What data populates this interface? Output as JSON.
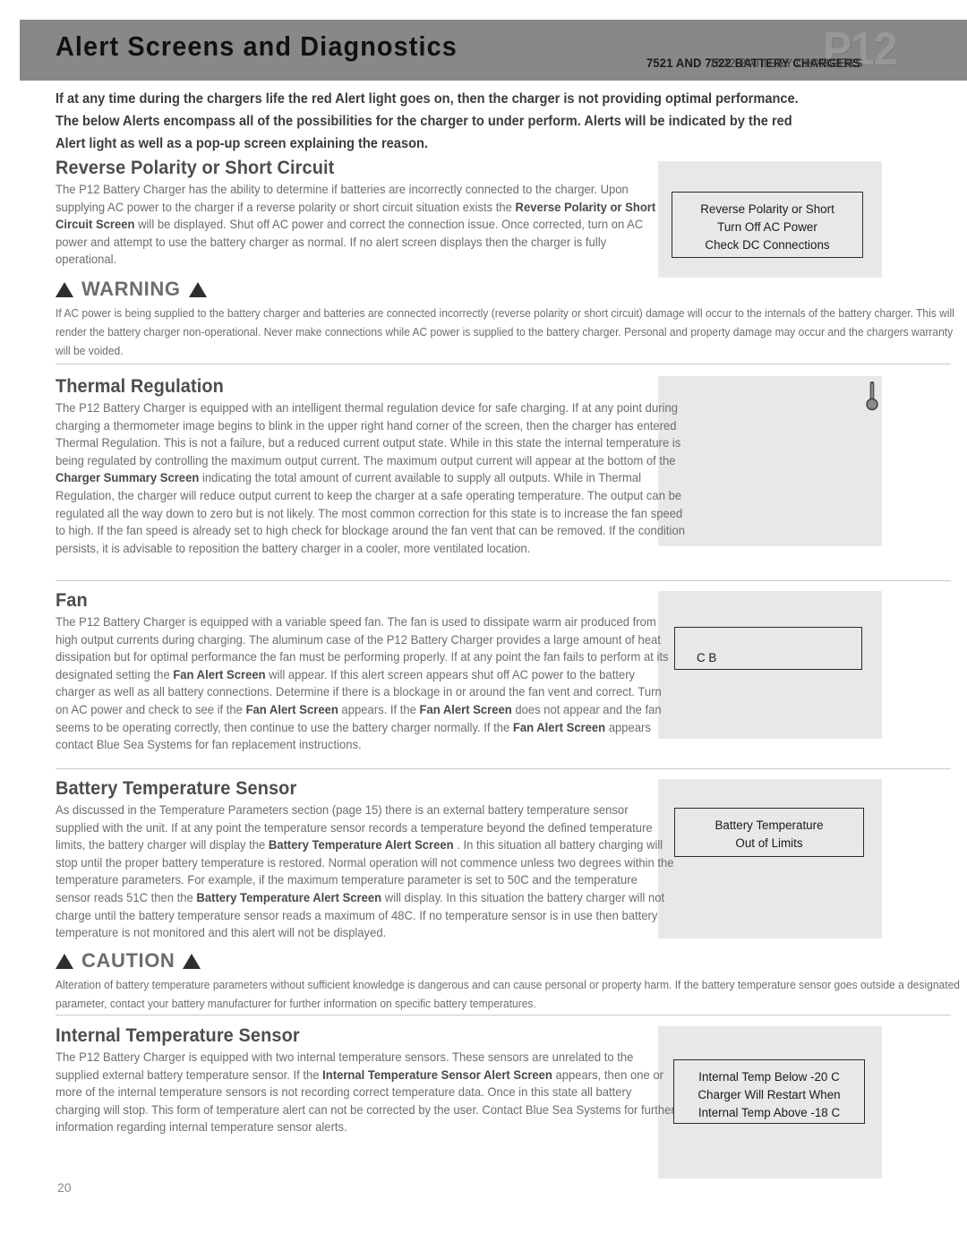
{
  "header": {
    "title": "Alert Screens and Diagnostics",
    "watermark": "P12",
    "subtitle": "7521 AND 7522 BATTERY CHARGERS",
    "subtitle_overlay": "7522 BATTERY CHARGERS"
  },
  "lead": "If at any time during the chargers life the red Alert light goes on, then the charger is not providing optimal performance. The below Alerts encompass all of the possibilities for the charger to under perform.  Alerts will be indicated by the red Alert light as well as a pop-up screen explaining the reason.",
  "sections": {
    "reverse_polarity": {
      "title": "Reverse Polarity or Short Circuit",
      "p1a": "The P12 Battery Charger has the ability to determine if batteries are incorrectly connected to the charger. Upon supplying ",
      "p1b": "AC",
      "p1c": " power to the charger if a reverse polarity or short circuit situation exists the ",
      "emph1": "Reverse Polarity or Short Circuit Screen",
      "p1d": " will be displayed. Shut off ",
      "p1e": "AC",
      "p1f": " power and correct the connection issue. ",
      "p1g": "On",
      "p1h": "ce corrected, turn on ",
      "p1i": "AC",
      "p1j": " power and attempt to use the battery charger as normal. If no alert screen displays then the charger is fully operational.",
      "alert_lines": [
        "Reverse Polarity or Short",
        "Turn Off AC Power",
        "Check DC Connections"
      ]
    },
    "warning": {
      "heading": "WARNING",
      "text": "If AC power is being supplied to the battery charger and batteries are connected incorrectly (reverse polarity or short circuit) damage will occur to the internals of the battery charger. This will render the battery charger non-operational. Never make connections while AC power is supplied to the battery charger. Personal and property damage may occur and the chargers warranty will be voided."
    },
    "thermal": {
      "title": "Thermal Regulation",
      "p1": "The P12 Battery Charger is equipped with an intelligent thermal regulation device for safe charging. If at any point during charging a thermometer image begins to blink in the upper right hand corner of the screen, then the charger has entered Thermal Regulation. This is not a failure, but a reduced current output state. While in this state the internal temperature is being regulated by controlling the maximum output current. The maximum output current will appear at the bottom of the ",
      "emph1": "Charger Summary Screen",
      "p2": " indicating the total amount of current available to supply all outputs. While in Thermal Regulation, the charger will reduce output current to keep the charger at a safe operating temperature. The output can be regulated all the way down to zero but is not likely. The most common correction for this state is to increase the fan speed to high. If the fan speed is already set to high check for blockage around the fan vent that can be removed. If the condition persists, it is advisable to reposition the battery charger in a cooler, more ventilated location.",
      "icon": "thermometer-icon"
    },
    "fan": {
      "title": "Fan",
      "p1": "The P12 Battery Charger is equipped with a variable speed fan. The fan is used to dissipate warm air produced from high output currents during charging. The aluminum case of the P12 Battery Charger provides a large amount of heat dissipation but for optimal performance the fan must be performing properly. If at any point the fan fails to perform at its designated setting the ",
      "emph1": "Fan Alert Screen",
      "p2": " will appear. If this alert screen appears shut off ",
      "p2b": "AC",
      "p2c": " power to the battery charger as well as all battery connections. Determine if there is a blockage in or around the fan vent and correct. Turn on ",
      "p2d": "AC",
      "p2e": " power and check to see if the ",
      "emph2": "Fan Alert Screen",
      "p3": " appears. If the ",
      "emph3": "Fan Alert Screen",
      "p4": " does not appear and the fan seems to be operating correctly, then continue to use the battery charger normally. If the ",
      "emph4": "Fan Alert Screen",
      "p5": " appears contact Blue Sea Systems for fan replacement instructions.",
      "alert_lines": [
        "C  B"
      ]
    },
    "battery_temp": {
      "title": "Battery Temperature Sensor",
      "p1": "As discussed in the Temperature Parameters section (page 15) there is an external battery temperature sensor supplied with the unit. If at any point the temperature sensor records a temperature beyond the defined temperature limits, the battery charger will display the ",
      "emph1": "Battery Temperature Alert Screen",
      "p2": " . In this situation all battery charging will stop until the proper battery temperature is restored. Normal operation will not commence unless two degrees within the temperature parameters. For example, if the maximum temperature parameter is set to 50C and the temperature sensor reads 51C then the ",
      "emph2": "Battery Temperature Alert Screen",
      "p3": " will display. In this situation the battery charger will not charge until the battery temperature sensor reads a maximum of 48C. If no temperature sensor is in use then battery temperature is not monitored and this alert will not be displayed.",
      "alert_lines": [
        "Battery Temperature",
        "Out of Limits"
      ]
    },
    "caution": {
      "heading": "CAUTION",
      "text": "Alteration of battery temperature parameters without sufficient knowledge is dangerous and can cause personal or property harm. If the battery temperature sensor goes outside a designated parameter, contact your battery manufacturer for further information on specific battery temperatures."
    },
    "internal_temp": {
      "title": "Internal Temperature Sensor",
      "p1": "The P12 Battery Charger is equipped with two internal temperature sensors. These sensors are unrelated to the supplied external battery temperature sensor. If the ",
      "emph1": "Internal Temperature Sensor Alert Screen",
      "p2": " appears, then one or more of the internal temperature sensors is not recording correct temperature data. Once in this state all battery charging will stop.  This form of temperature alert can not be corrected by the user. Contact Blue Sea Systems for further information regarding internal temperature sensor alerts.",
      "alert_lines": [
        "Internal Temp Below -20  C",
        "Charger Will Restart When",
        "Internal Temp Above -18  C"
      ]
    }
  },
  "page_number": "20",
  "colors": {
    "header_band": "#888888",
    "body_text": "#6d6d6d",
    "heading_text": "#4d4d4d",
    "panel_gray": "#e8e8e8",
    "rule": "#c9c9c9"
  }
}
